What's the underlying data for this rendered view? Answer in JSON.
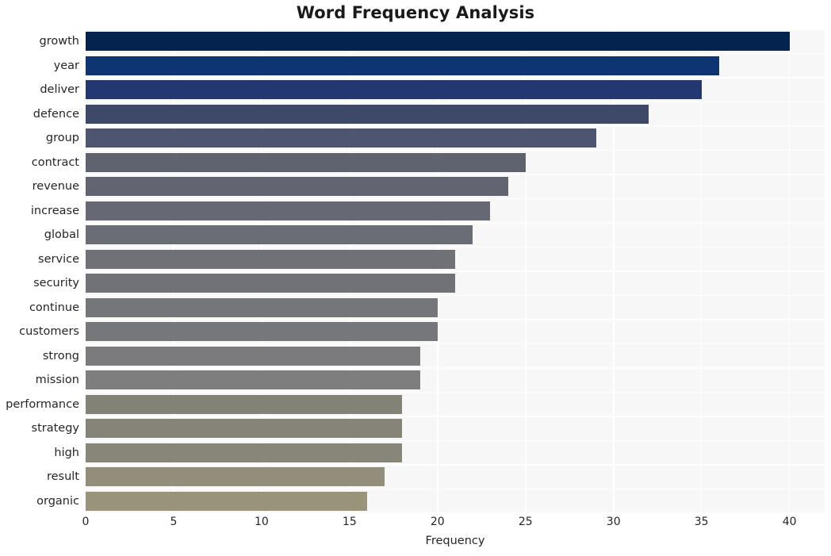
{
  "chart_data": {
    "type": "bar",
    "orientation": "horizontal",
    "title": "Word Frequency Analysis",
    "xlabel": "Frequency",
    "ylabel": "",
    "categories": [
      "growth",
      "year",
      "deliver",
      "defence",
      "group",
      "contract",
      "revenue",
      "increase",
      "global",
      "service",
      "security",
      "continue",
      "customers",
      "strong",
      "mission",
      "performance",
      "strategy",
      "high",
      "result",
      "organic"
    ],
    "values": [
      40,
      36,
      35,
      32,
      29,
      25,
      24,
      23,
      22,
      21,
      21,
      20,
      20,
      19,
      19,
      18,
      18,
      18,
      17,
      16
    ],
    "bar_colors": [
      "#04234f",
      "#0d3572",
      "#22386e",
      "#3e4868",
      "#4d5570",
      "#5f6370",
      "#626571",
      "#666973",
      "#6b6d75",
      "#6f7177",
      "#717278",
      "#75767a",
      "#76777b",
      "#7b7b7d",
      "#7e7e7f",
      "#838276",
      "#868478",
      "#888678",
      "#938e7b",
      "#99937a"
    ],
    "xlim": [
      0,
      42.0
    ],
    "xticks": [
      0,
      5,
      10,
      15,
      20,
      25,
      30,
      35,
      40
    ],
    "xticklabels": [
      "0",
      "5",
      "10",
      "15",
      "20",
      "25",
      "30",
      "35",
      "40"
    ],
    "grid": true,
    "grid_color": "#ffffff",
    "plot_background": "#f7f7f7",
    "figure_background": "#ffffff",
    "legend": null,
    "legend_position": "none"
  }
}
